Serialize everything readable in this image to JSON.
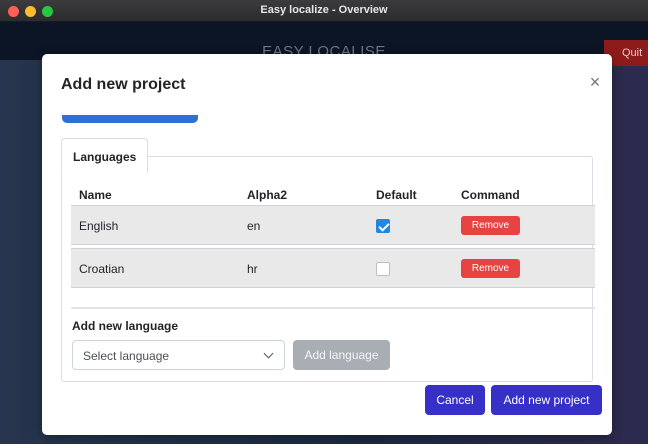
{
  "window": {
    "title": "Easy localize - Overview"
  },
  "app": {
    "title": "EASY LOCALISE",
    "quit_label": "Quit"
  },
  "modal": {
    "title": "Add new project",
    "close_glyph": "×",
    "languages_tab_label": "Languages",
    "table": {
      "headers": [
        "Name",
        "Alpha2",
        "Default",
        "Command"
      ],
      "rows": [
        {
          "name": "English",
          "alpha2": "en",
          "default": true,
          "command": "Remove"
        },
        {
          "name": "Croatian",
          "alpha2": "hr",
          "default": false,
          "command": "Remove"
        }
      ]
    },
    "add_language_label": "Add new language",
    "select_placeholder": "Select language",
    "add_language_button": "Add language",
    "cancel_button": "Cancel",
    "add_project_button": "Add new project"
  },
  "icons": {
    "close": "close-icon",
    "chevron": "chevron-down-icon",
    "check": "checkmark-icon"
  },
  "colors": {
    "primary": "#3630c8",
    "danger": "#e74343",
    "checkbox_on": "#1e88e5",
    "disabled": "#a9aeb4"
  }
}
